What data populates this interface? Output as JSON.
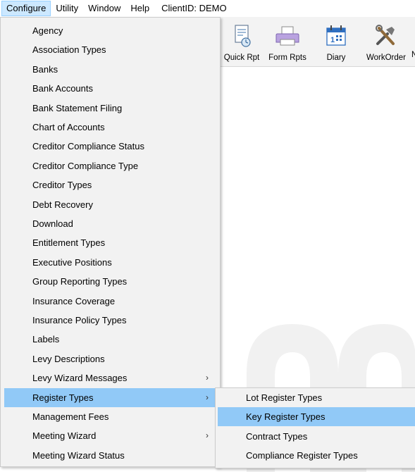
{
  "menubar": {
    "items": [
      "Configure",
      "Utility",
      "Window",
      "Help"
    ],
    "client": "ClientID: DEMO"
  },
  "toolbar": {
    "buttons": [
      {
        "label": "Quick Rpt",
        "icon": "quick-report-icon"
      },
      {
        "label": "Form Rpts",
        "icon": "printer-icon"
      },
      {
        "label": "Diary",
        "icon": "calendar-icon"
      },
      {
        "label": "WorkOrder",
        "icon": "tools-icon"
      }
    ],
    "cut_off_label": "N"
  },
  "configure_menu": {
    "items": [
      {
        "label": "Agency"
      },
      {
        "label": "Association Types"
      },
      {
        "label": "Banks"
      },
      {
        "label": "Bank Accounts"
      },
      {
        "label": "Bank Statement Filing"
      },
      {
        "label": "Chart of Accounts"
      },
      {
        "label": "Creditor Compliance Status"
      },
      {
        "label": "Creditor Compliance Type"
      },
      {
        "label": "Creditor Types"
      },
      {
        "label": "Debt Recovery"
      },
      {
        "label": "Download"
      },
      {
        "label": "Entitlement Types"
      },
      {
        "label": "Executive Positions"
      },
      {
        "label": "Group Reporting Types"
      },
      {
        "label": "Insurance Coverage"
      },
      {
        "label": "Insurance Policy Types"
      },
      {
        "label": "Labels"
      },
      {
        "label": "Levy Descriptions"
      },
      {
        "label": "Levy Wizard Messages",
        "submenu": true
      },
      {
        "label": "Register Types",
        "submenu": true,
        "highlighted": true
      },
      {
        "label": "Management Fees"
      },
      {
        "label": "Meeting Wizard",
        "submenu": true
      },
      {
        "label": "Meeting Wizard Status"
      }
    ],
    "submenu_arrow": "›"
  },
  "register_types_submenu": {
    "items": [
      {
        "label": "Lot Register Types"
      },
      {
        "label": "Key Register Types",
        "highlighted": true
      },
      {
        "label": "Contract Types"
      },
      {
        "label": "Compliance Register Types"
      }
    ]
  },
  "colors": {
    "highlight": "#91c9f7",
    "menu_bg": "#f2f2f2",
    "active_menubar": "#cce8ff"
  }
}
